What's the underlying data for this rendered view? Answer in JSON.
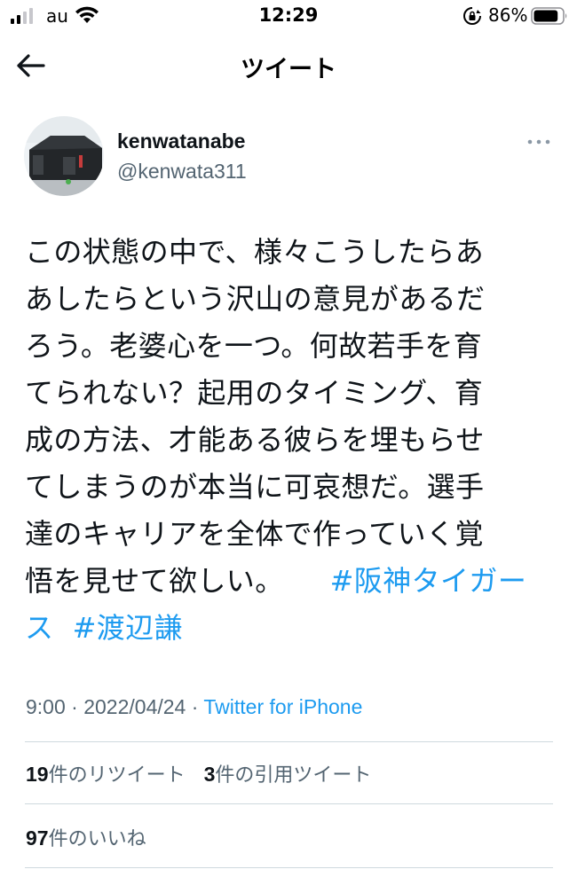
{
  "status_bar": {
    "carrier": "au",
    "time": "12:29",
    "battery_percent": "86%",
    "battery_level": 0.86,
    "icons": [
      "signal-icon",
      "wifi-icon",
      "orientation-lock-icon",
      "battery-icon"
    ]
  },
  "nav": {
    "title": "ツイート",
    "back_icon": "back-arrow-icon"
  },
  "tweet": {
    "author": {
      "display_name": "kenwatanabe",
      "handle": "@kenwata311"
    },
    "more_icon": "more-options-icon",
    "text_lines": [
      "この状態の中で、様々こうしたらあ",
      "あしたらという沢山の意見があるだ",
      "ろう。老婆心を一つ。何故若手を育",
      "てられない？起用のタイミング、育",
      "成の方法、才能ある彼らを埋もらせ",
      "てしまうのが本当に可哀想だ。選手",
      "達のキャリアを全体で作っていく覚"
    ],
    "text_last_line": "悟を見せて欲しい。",
    "hashtags": [
      "#阪神タイガース",
      "#渡辺謙"
    ],
    "time": "9:00",
    "separator": "·",
    "date": "2022/04/24",
    "source": "Twitter for iPhone"
  },
  "stats": {
    "retweets_count": "19",
    "retweets_label": "件のリツイート",
    "quotes_count": "3",
    "quotes_label": "件の引用ツイート",
    "likes_count": "97",
    "likes_label": "件のいいね"
  },
  "colors": {
    "link": "#1d9bf0",
    "secondary_text": "#536471",
    "primary_text": "#0f1419",
    "divider": "#cfd9de"
  }
}
